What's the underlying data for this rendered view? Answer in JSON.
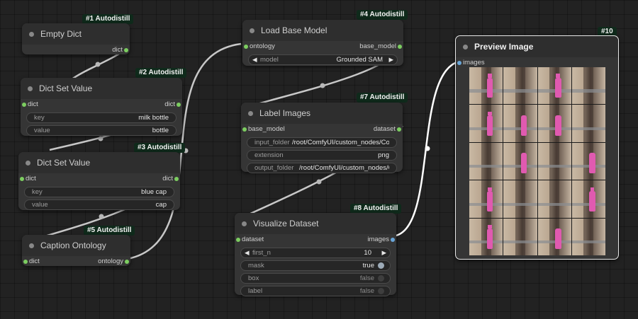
{
  "nodes": {
    "empty_dict": {
      "badge": "#1 Autodistill",
      "title": "Empty Dict",
      "out": "dict"
    },
    "dict_set_1": {
      "badge": "#2 Autodistill",
      "title": "Dict Set Value",
      "in": "dict",
      "out": "dict",
      "widgets": [
        {
          "label": "key",
          "value": "milk bottle"
        },
        {
          "label": "value",
          "value": "bottle"
        }
      ]
    },
    "dict_set_2": {
      "badge": "#3 Autodistill",
      "title": "Dict Set Value",
      "in": "dict",
      "out": "dict",
      "widgets": [
        {
          "label": "key",
          "value": "blue cap"
        },
        {
          "label": "value",
          "value": "cap"
        }
      ]
    },
    "caption_ontology": {
      "badge": "#5 Autodistill",
      "title": "Caption Ontology",
      "in": "dict",
      "out": "ontology"
    },
    "load_base_model": {
      "badge": "#4 Autodistill",
      "title": "Load Base Model",
      "in": "ontology",
      "out": "base_model",
      "combo": {
        "label": "model",
        "value": "Grounded SAM"
      }
    },
    "label_images": {
      "badge": "#7 Autodistill",
      "title": "Label Images",
      "in": "base_model",
      "out": "dataset",
      "widgets": [
        {
          "label": "input_folder",
          "value": "/root/ComfyUI/custom_nodes/Com"
        },
        {
          "label": "extension",
          "value": "png"
        },
        {
          "label": "output_folder",
          "value": "/root/ComfyUI/custom_nodes/Com"
        }
      ]
    },
    "visualize_dataset": {
      "badge": "#8 Autodistill",
      "title": "Visualize Dataset",
      "in": "dataset",
      "out": "images",
      "number": {
        "label": "first_n",
        "value": "10"
      },
      "toggles": [
        {
          "label": "mask",
          "value": "true"
        },
        {
          "label": "box",
          "value": "false"
        },
        {
          "label": "label",
          "value": "false"
        }
      ]
    },
    "preview_image": {
      "badge": "#10",
      "title": "Preview Image",
      "in": "images"
    }
  },
  "colors": {
    "link": "#c8c8c8",
    "link_active": "#ffffff",
    "slot_dict": "#7ccd60",
    "slot_images": "#6aa6d8",
    "badge_bg": "#0f2a1b"
  },
  "icons": {
    "arrow_left": "◀",
    "arrow_right": "▶"
  }
}
